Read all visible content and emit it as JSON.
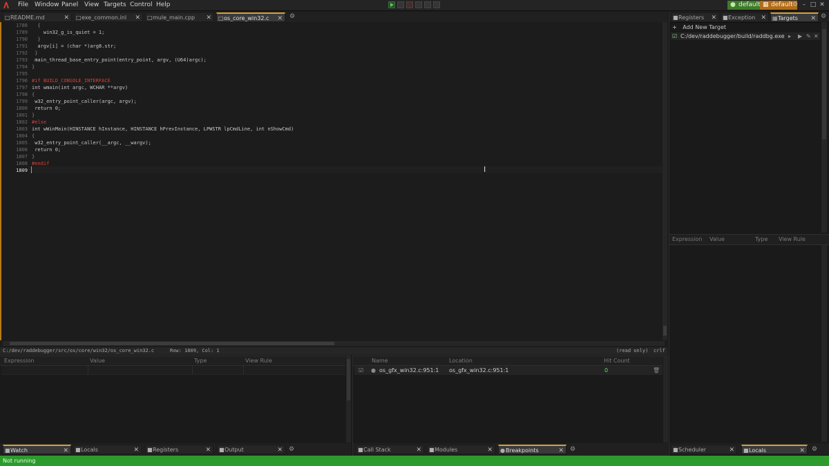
{
  "menubar": {
    "items": [
      "File",
      "Window",
      "Panel",
      "View",
      "Targets",
      "Control",
      "Help"
    ],
    "user_label": "default",
    "profile_label": "default"
  },
  "editor": {
    "tabs": [
      {
        "label": "README.md",
        "active": false
      },
      {
        "label": "exe_common.inl",
        "active": false
      },
      {
        "label": "mule_main.cpp",
        "active": false
      },
      {
        "label": "os_core_win32.c",
        "active": true
      }
    ],
    "lines": [
      {
        "num": "1788",
        "text": "  {",
        "kind": "dim"
      },
      {
        "num": "1789",
        "text": "    win32_g_is_quiet = 1;",
        "kind": "code"
      },
      {
        "num": "1790",
        "text": "  }",
        "kind": "dim"
      },
      {
        "num": "1791",
        "text": "  argv[i] = (char *)arg8.str;",
        "kind": "code"
      },
      {
        "num": "1792",
        "text": " }",
        "kind": "dim"
      },
      {
        "num": "1793",
        "text": " main_thread_base_entry_point(entry_point, argv, (U64)argc);",
        "kind": "code"
      },
      {
        "num": "1794",
        "text": "}",
        "kind": "dim"
      },
      {
        "num": "1795",
        "text": "",
        "kind": "code"
      },
      {
        "num": "1796",
        "text": "#if BUILD_CONSOLE_INTERFACE",
        "kind": "pp"
      },
      {
        "num": "1797",
        "text": "int wmain(int argc, WCHAR **argv)",
        "kind": "code"
      },
      {
        "num": "1798",
        "text": "{",
        "kind": "dim"
      },
      {
        "num": "1799",
        "text": " w32_entry_point_caller(argc, argv);",
        "kind": "code"
      },
      {
        "num": "1800",
        "text": " return 0;",
        "kind": "code"
      },
      {
        "num": "1801",
        "text": "}",
        "kind": "dim"
      },
      {
        "num": "1802",
        "text": "#else",
        "kind": "pp"
      },
      {
        "num": "1803",
        "text": "int wWinMain(HINSTANCE hInstance, HINSTANCE hPrevInstance, LPWSTR lpCmdLine, int nShowCmd)",
        "kind": "code"
      },
      {
        "num": "1804",
        "text": "{",
        "kind": "dim"
      },
      {
        "num": "1805",
        "text": " w32_entry_point_caller(__argc, __wargv);",
        "kind": "code"
      },
      {
        "num": "1806",
        "text": " return 0;",
        "kind": "code"
      },
      {
        "num": "1807",
        "text": "}",
        "kind": "dim"
      },
      {
        "num": "1808",
        "text": "#endif",
        "kind": "pp"
      },
      {
        "num": "1809",
        "text": "",
        "kind": "code"
      }
    ],
    "status_path": "C:/dev/raddebugger/src/os/core/win32/os_core_win32.c",
    "status_pos": "Row: 1809, Col: 1",
    "status_mode": "(read only)",
    "status_eol": "crlf"
  },
  "right_panel": {
    "tabs": [
      "Registers",
      "Exception",
      "Targets"
    ],
    "add_target": "Add New Target",
    "target_path": "C:/dev/raddebugger/build/raddbg.exe",
    "watch_columns": [
      "Expression",
      "Value",
      "Type",
      "View Rule"
    ],
    "bottom_tabs": [
      "Scheduler",
      "Locals"
    ]
  },
  "watch_panel": {
    "columns": [
      "Expression",
      "Value",
      "Type",
      "View Rule"
    ],
    "bottom_tabs": [
      "Watch",
      "Locals",
      "Registers",
      "Output"
    ]
  },
  "breakpoints_panel": {
    "columns": [
      "Name",
      "Location",
      "Hit Count"
    ],
    "rows": [
      {
        "name": "os_gfx_win32.c:951:1",
        "location": "os_gfx_win32.c:951:1",
        "hits": "0"
      }
    ],
    "bottom_tabs": [
      "Call Stack",
      "Modules",
      "Breakpoints"
    ]
  },
  "statusbar": {
    "text": "Not running"
  },
  "colors": {
    "accent": "#d6a23a",
    "status_green": "#2c9a2c",
    "profile_orange": "#b26c17"
  }
}
